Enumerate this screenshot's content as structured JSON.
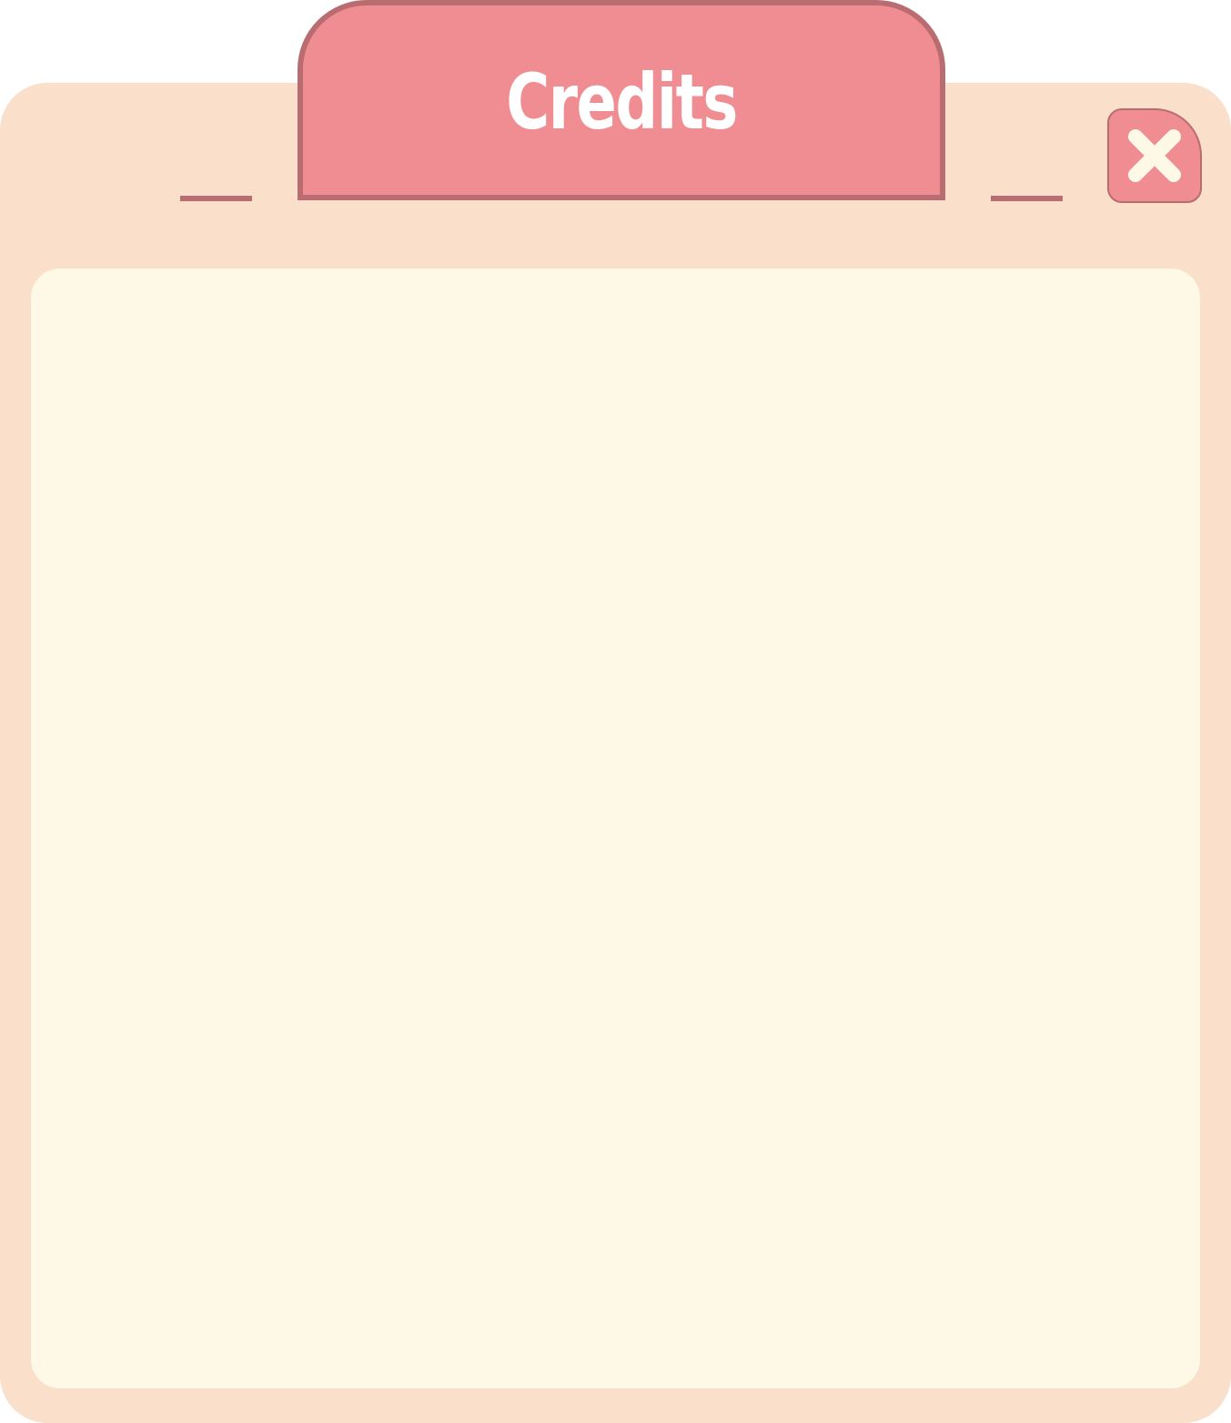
{
  "dialog": {
    "title": "Credits",
    "close_icon": "close-icon",
    "colors": {
      "panel": "#fadfca",
      "tab": "#ef8d93",
      "outline": "#b96d71",
      "content": "#fdf9e6",
      "title_text": "#ffffff",
      "icon": "#fdf9e6"
    }
  }
}
